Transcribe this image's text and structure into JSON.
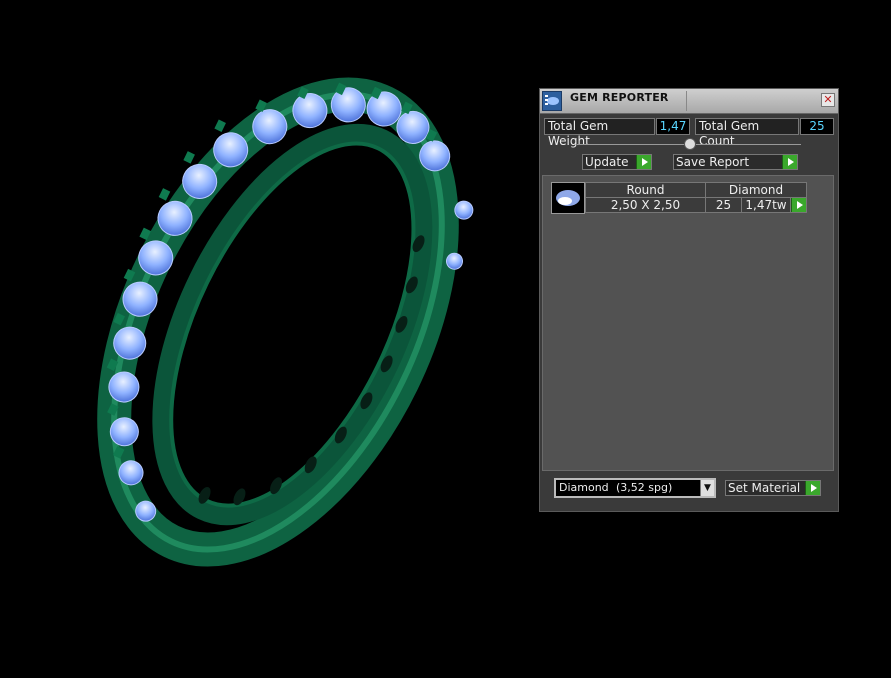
{
  "panel": {
    "title": "GEM REPORTER",
    "close_glyph": "✕",
    "total_weight_label": "Total Gem Weight",
    "total_weight_value": "1,47",
    "total_count_label": "Total Gem Count",
    "total_count_value": "25",
    "update_label": "Update",
    "save_report_label": "Save Report",
    "table": {
      "shape": "Round",
      "material": "Diamond",
      "size": "2,50 X 2,50",
      "count": "25",
      "weight": "1,47tw"
    },
    "material_select": {
      "selected_name": "Diamond",
      "selected_spg": "(3,52 spg)"
    },
    "set_material_label": "Set Material"
  },
  "colors": {
    "metal": "#0f6a45",
    "gem": "#8fb8ff",
    "value_text": "#59d6ff",
    "play_button": "#3aa82c"
  }
}
